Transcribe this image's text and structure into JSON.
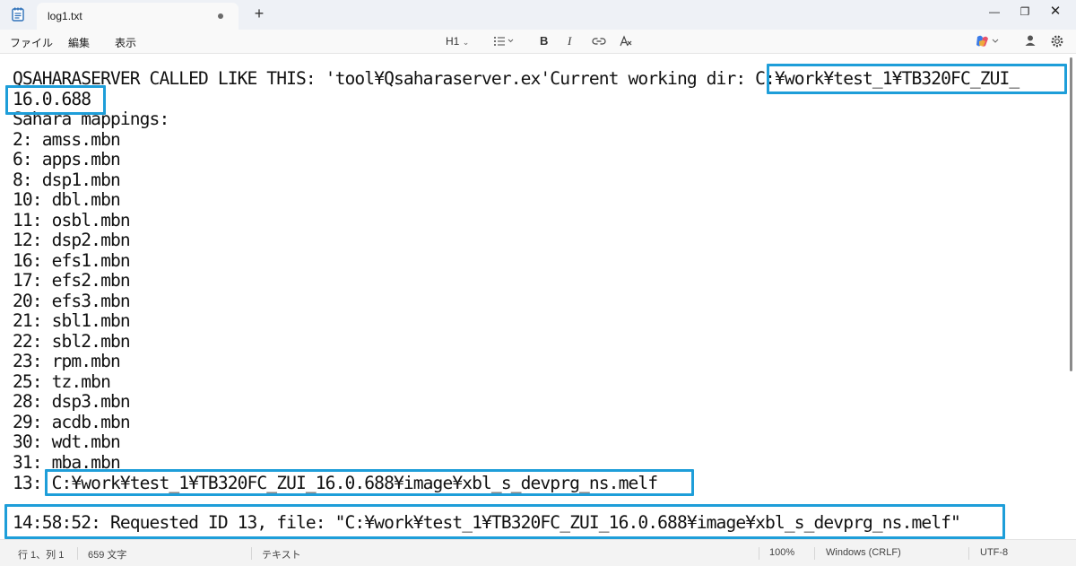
{
  "tab": {
    "title": "log1.txt"
  },
  "titlebar": {
    "new_tab": "+",
    "minimize": "—",
    "maximize": "❐",
    "close": "✕"
  },
  "menu": {
    "file": "ファイル",
    "edit": "編集",
    "view": "表示"
  },
  "toolbar": {
    "heading": "H1",
    "bold": "B",
    "italic": "I"
  },
  "content": {
    "lines": [
      "QSAHARASERVER CALLED LIKE THIS: 'tool¥Qsaharaserver.ex'Current working dir: C:¥work¥test_1¥TB320FC_ZUI_",
      "16.0.688",
      "Sahara mappings:",
      "2: amss.mbn",
      "6: apps.mbn",
      "8: dsp1.mbn",
      "10: dbl.mbn",
      "11: osbl.mbn",
      "12: dsp2.mbn",
      "16: efs1.mbn",
      "17: efs2.mbn",
      "20: efs3.mbn",
      "21: sbl1.mbn",
      "22: sbl2.mbn",
      "23: rpm.mbn",
      "25: tz.mbn",
      "28: dsp3.mbn",
      "29: acdb.mbn",
      "30: wdt.mbn",
      "31: mba.mbn",
      "13: C:¥work¥test_1¥TB320FC_ZUI_16.0.688¥image¥xbl_s_devprg_ns.melf"
    ],
    "last_line": "14:58:52: Requested ID 13, file: \"C:¥work¥test_1¥TB320FC_ZUI_16.0.688¥image¥xbl_s_devprg_ns.melf\""
  },
  "status": {
    "position": "行 1、列 1",
    "chars": "659 文字",
    "format": "テキスト",
    "zoom": "100%",
    "line_ending": "Windows (CRLF)",
    "encoding": "UTF-8"
  },
  "colors": {
    "highlight": "#1e9ed9",
    "titlebar": "#eef1f6"
  }
}
